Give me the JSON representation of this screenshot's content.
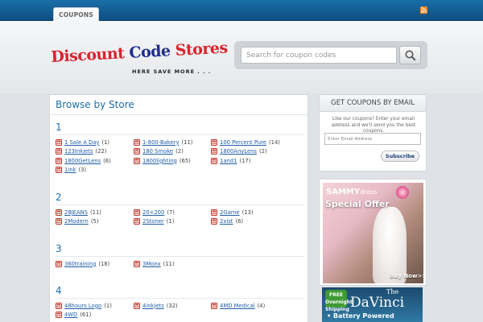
{
  "nav": {
    "tab_label": "COUPONS"
  },
  "logo": {
    "word1": "Discount",
    "word2": "Code",
    "word3": "Stores",
    "tagline": "HERE SAVE MORE . . ."
  },
  "search": {
    "placeholder": "Search for coupon codes"
  },
  "main": {
    "title": "Browse by Store",
    "sections": [
      {
        "letter": "1",
        "stores": [
          {
            "name": "1 Sale A Day",
            "count": "(1)"
          },
          {
            "name": "1-800-Bakery",
            "count": "(11)"
          },
          {
            "name": "100 Percent Pure",
            "count": "(14)"
          },
          {
            "name": "123Inkjets",
            "count": "(22)"
          },
          {
            "name": "180 Smoke",
            "count": "(2)"
          },
          {
            "name": "1800AnyLens",
            "count": "(2)"
          },
          {
            "name": "1800GetLens",
            "count": "(6)"
          },
          {
            "name": "1800lighting",
            "count": "(65)"
          },
          {
            "name": "1and1",
            "count": "(17)"
          },
          {
            "name": "1ink",
            "count": "(3)"
          }
        ]
      },
      {
        "letter": "2",
        "stores": [
          {
            "name": "28JEANS",
            "count": "(11)"
          },
          {
            "name": "20×200",
            "count": "(7)"
          },
          {
            "name": "2Game",
            "count": "(13)"
          },
          {
            "name": "2Modern",
            "count": "(5)"
          },
          {
            "name": "2Stoner",
            "count": "(1)"
          },
          {
            "name": "2xist",
            "count": "(6)"
          }
        ]
      },
      {
        "letter": "3",
        "stores": [
          {
            "name": "360training",
            "count": "(18)"
          },
          {
            "name": "3Monx",
            "count": "(11)"
          }
        ]
      },
      {
        "letter": "4",
        "stores": [
          {
            "name": "48hours Logo",
            "count": "(1)"
          },
          {
            "name": "4inkjets",
            "count": "(32)"
          },
          {
            "name": "4MD Medical",
            "count": "(4)"
          },
          {
            "name": "4WD",
            "count": "(61)"
          }
        ]
      }
    ]
  },
  "email_box": {
    "title": "GET COUPONS BY EMAIL",
    "description": "Like our coupons? Enter your email address and we'll send you the best coupons.",
    "placeholder": "Enter Email Address",
    "button_label": "Subscribe"
  },
  "ads": {
    "sammy": {
      "brand": "SAMMY",
      "brand_suffix": "dress",
      "offer": "Special Offer",
      "cta": "Buy Now>>"
    },
    "davinci": {
      "badge": "FREE Overnight Shipping",
      "the": "The",
      "name": "DaVinci",
      "tagline": "• Battery Powered"
    }
  },
  "colors": {
    "accent": "#1f6ea9",
    "link": "#1f5ea8",
    "topbar": "#0d4f83"
  }
}
